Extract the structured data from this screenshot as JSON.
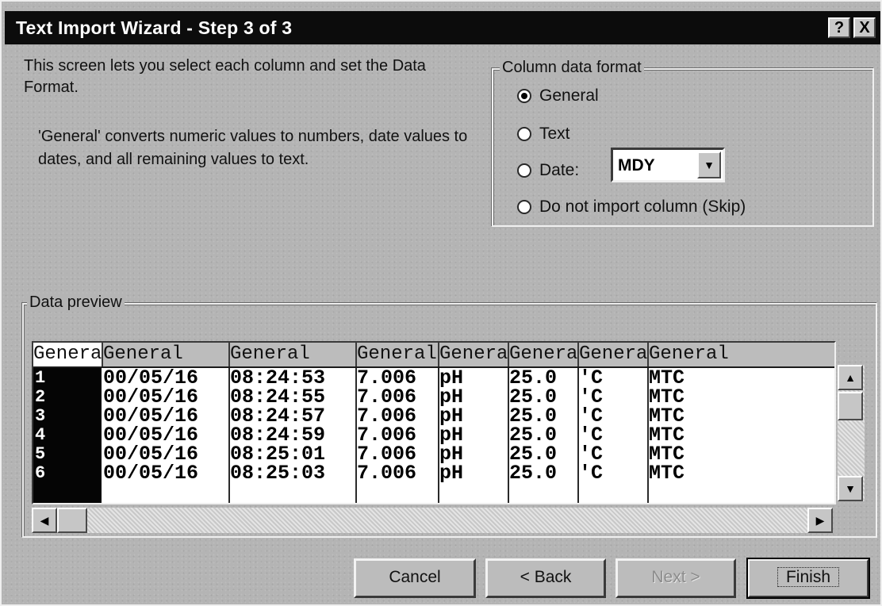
{
  "window": {
    "title": "Text Import Wizard - Step 3 of 3",
    "help_label": "?",
    "close_label": "X"
  },
  "description": {
    "line1": "This screen lets you select each column and set the Data Format.",
    "line2": "'General' converts numeric values to numbers, date values to dates, and all remaining values to text."
  },
  "column_format": {
    "legend": "Column data format",
    "options": [
      {
        "label": "General",
        "checked": true
      },
      {
        "label": "Text",
        "checked": false
      },
      {
        "label": "Date:",
        "checked": false
      },
      {
        "label": "Do not import column (Skip)",
        "checked": false
      }
    ],
    "date_value": "MDY",
    "dropdown_arrow": "▼"
  },
  "preview": {
    "legend": "Data preview",
    "headers": [
      "General",
      "General",
      "General",
      "General",
      "General",
      "General",
      "General",
      "General"
    ],
    "rows": [
      [
        "1",
        "00/05/16",
        "08:24:53",
        "7.006",
        "pH",
        "25.0",
        "'C",
        "MTC"
      ],
      [
        "2",
        "00/05/16",
        "08:24:55",
        "7.006",
        "pH",
        "25.0",
        "'C",
        "MTC"
      ],
      [
        "3",
        "00/05/16",
        "08:24:57",
        "7.006",
        "pH",
        "25.0",
        "'C",
        "MTC"
      ],
      [
        "4",
        "00/05/16",
        "08:24:59",
        "7.006",
        "pH",
        "25.0",
        "'C",
        "MTC"
      ],
      [
        "5",
        "00/05/16",
        "08:25:01",
        "7.006",
        "pH",
        "25.0",
        "'C",
        "MTC"
      ],
      [
        "6",
        "00/05/16",
        "08:25:03",
        "7.006",
        "pH",
        "25.0",
        "'C",
        "MTC"
      ]
    ],
    "scroll_up": "▲",
    "scroll_down": "▼",
    "scroll_left": "◀",
    "scroll_right": "▶"
  },
  "buttons": {
    "cancel": "Cancel",
    "back": "< Back",
    "next": "Next >",
    "finish": "Finish"
  }
}
